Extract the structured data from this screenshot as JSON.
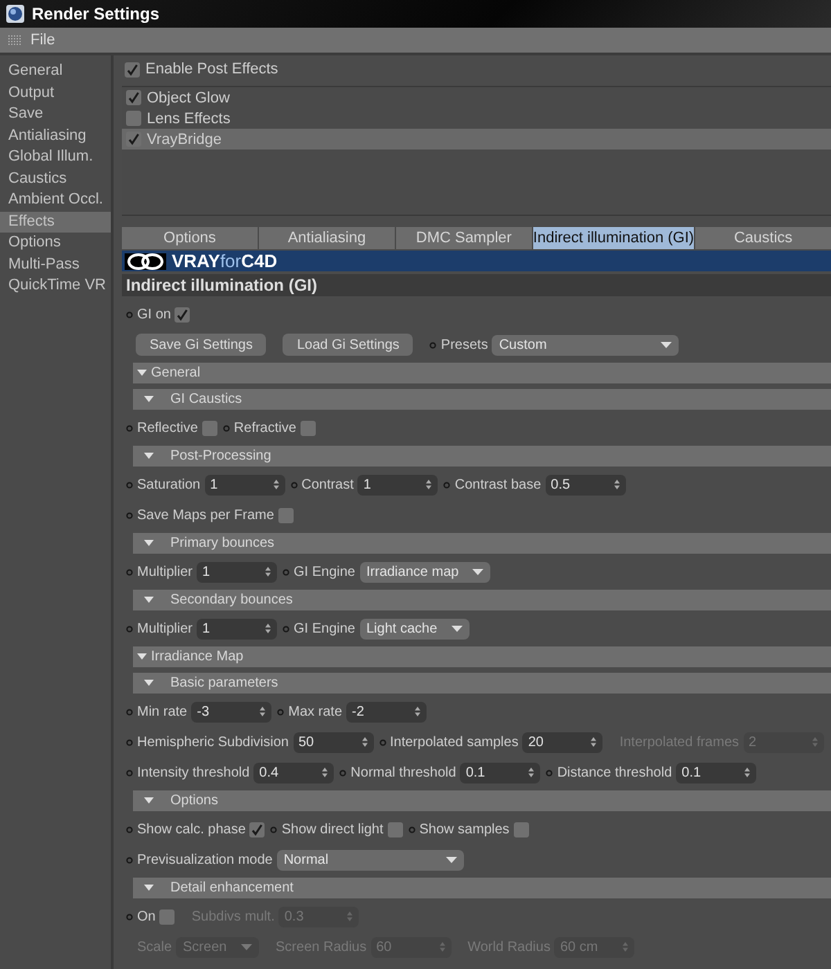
{
  "window": {
    "title": "Render Settings"
  },
  "menu": [
    "File"
  ],
  "sidebar": {
    "items": [
      {
        "label": "General",
        "selected": false
      },
      {
        "label": "Output",
        "selected": false
      },
      {
        "label": "Save",
        "selected": false
      },
      {
        "label": "Antialiasing",
        "selected": false
      },
      {
        "label": "Global Illum.",
        "selected": false
      },
      {
        "label": "Caustics",
        "selected": false
      },
      {
        "label": "Ambient Occl.",
        "selected": false
      },
      {
        "label": "Effects",
        "selected": true
      },
      {
        "label": "Options",
        "selected": false
      },
      {
        "label": "Multi-Pass",
        "selected": false
      },
      {
        "label": "QuickTime VR",
        "selected": false
      }
    ]
  },
  "enable_post_effects": {
    "label": "Enable Post Effects",
    "checked": true
  },
  "effects": [
    {
      "label": "Object Glow",
      "checked": true,
      "selected": false
    },
    {
      "label": "Lens Effects",
      "checked": false,
      "selected": false
    },
    {
      "label": "VrayBridge",
      "checked": true,
      "selected": true
    }
  ],
  "tabs": [
    {
      "label": "Options",
      "selected": false
    },
    {
      "label": "Antialiasing",
      "selected": false
    },
    {
      "label": "DMC Sampler",
      "selected": false
    },
    {
      "label": "Indirect illumination (GI)",
      "selected": true
    },
    {
      "label": "Caustics",
      "selected": false
    }
  ],
  "logo": [
    "VRAY",
    "for",
    "C4D"
  ],
  "panel_title": "Indirect illumination (GI)",
  "rows": [
    {
      "kind": "controls",
      "controls": [
        {
          "kind": "checkbox",
          "label": "GI on",
          "checked": true,
          "disabled": false
        }
      ]
    },
    {
      "kind": "controls",
      "controls": [
        {
          "kind": "button",
          "label": "Save Gi Settings"
        },
        {
          "kind": "button",
          "label": "Load Gi Settings"
        },
        {
          "kind": "dropdown",
          "label": "Presets",
          "value": "Custom",
          "disabled": false
        }
      ]
    },
    {
      "kind": "group",
      "label": "General"
    },
    {
      "kind": "subgroup",
      "label": "GI Caustics"
    },
    {
      "kind": "controls",
      "controls": [
        {
          "kind": "checkbox",
          "label": "Reflective",
          "checked": false,
          "disabled": false
        },
        {
          "kind": "checkbox",
          "label": "Refractive",
          "checked": false,
          "disabled": false
        }
      ]
    },
    {
      "kind": "subgroup",
      "label": "Post-Processing"
    },
    {
      "kind": "controls",
      "controls": [
        {
          "kind": "number",
          "label": "Saturation",
          "value": "1",
          "disabled": false
        },
        {
          "kind": "number",
          "label": "Contrast",
          "value": "1",
          "disabled": false
        },
        {
          "kind": "number",
          "label": "Contrast base",
          "value": "0.5",
          "disabled": false
        }
      ]
    },
    {
      "kind": "controls",
      "controls": [
        {
          "kind": "checkbox",
          "label": "Save Maps per Frame",
          "checked": false,
          "disabled": false
        }
      ]
    },
    {
      "kind": "subgroup",
      "label": "Primary bounces"
    },
    {
      "kind": "controls",
      "controls": [
        {
          "kind": "number",
          "label": "Multiplier",
          "value": "1",
          "disabled": false
        },
        {
          "kind": "dropdown",
          "label": "GI Engine",
          "value": "Irradiance map",
          "disabled": false
        }
      ]
    },
    {
      "kind": "subgroup",
      "label": "Secondary bounces"
    },
    {
      "kind": "controls",
      "controls": [
        {
          "kind": "number",
          "label": "Multiplier",
          "value": "1",
          "disabled": false
        },
        {
          "kind": "dropdown",
          "label": "GI Engine",
          "value": "Light cache",
          "disabled": false
        }
      ]
    },
    {
      "kind": "group",
      "label": "Irradiance Map"
    },
    {
      "kind": "subgroup",
      "label": "Basic parameters"
    },
    {
      "kind": "controls",
      "controls": [
        {
          "kind": "number",
          "label": "Min rate",
          "value": "-3",
          "disabled": false
        },
        {
          "kind": "number",
          "label": "Max rate",
          "value": "-2",
          "disabled": false
        }
      ]
    },
    {
      "kind": "controls",
      "controls": [
        {
          "kind": "number",
          "label": "Hemispheric Subdivision",
          "value": "50",
          "disabled": false
        },
        {
          "kind": "number",
          "label": "Interpolated samples",
          "value": "20",
          "disabled": false
        },
        {
          "kind": "number",
          "label": "Interpolated frames",
          "value": "2",
          "disabled": true
        }
      ]
    },
    {
      "kind": "controls",
      "controls": [
        {
          "kind": "number",
          "label": "Intensity threshold",
          "value": "0.4",
          "disabled": false
        },
        {
          "kind": "number",
          "label": "Normal threshold",
          "value": "0.1",
          "disabled": false
        },
        {
          "kind": "number",
          "label": "Distance threshold",
          "value": "0.1",
          "disabled": false
        }
      ]
    },
    {
      "kind": "subgroup",
      "label": "Options"
    },
    {
      "kind": "controls",
      "controls": [
        {
          "kind": "checkbox",
          "label": "Show calc. phase",
          "checked": true,
          "disabled": false
        },
        {
          "kind": "checkbox",
          "label": "Show direct light",
          "checked": false,
          "disabled": false
        },
        {
          "kind": "checkbox",
          "label": "Show samples",
          "checked": false,
          "disabled": false
        }
      ]
    },
    {
      "kind": "controls",
      "controls": [
        {
          "kind": "dropdown",
          "label": "Previsualization mode",
          "value": "Normal",
          "disabled": false
        }
      ]
    },
    {
      "kind": "subgroup",
      "label": "Detail enhancement"
    },
    {
      "kind": "controls",
      "controls": [
        {
          "kind": "checkbox",
          "label": "On",
          "checked": false,
          "disabled": false
        },
        {
          "kind": "number",
          "label": "Subdivs mult.",
          "value": "0.3",
          "disabled": true
        }
      ]
    },
    {
      "kind": "controls",
      "controls": [
        {
          "kind": "dropdown",
          "label": "Scale",
          "value": "Screen",
          "disabled": true
        },
        {
          "kind": "number",
          "label": "Screen Radius",
          "value": "60",
          "disabled": true
        },
        {
          "kind": "number",
          "label": "World Radius",
          "value": "60 cm",
          "disabled": true
        }
      ]
    }
  ]
}
